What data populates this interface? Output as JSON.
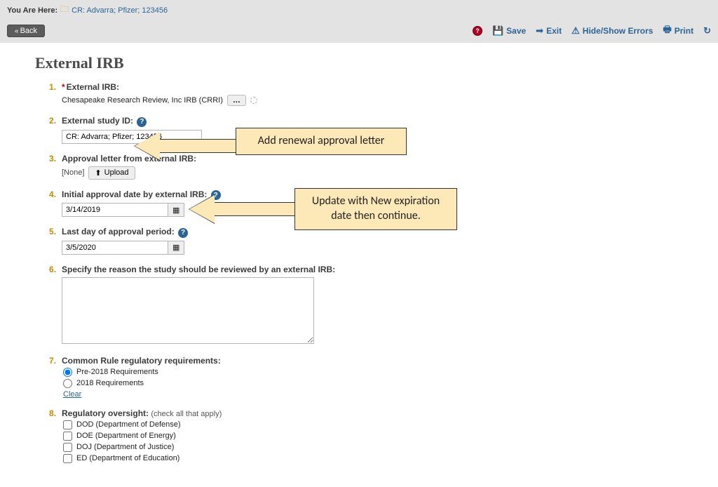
{
  "breadcrumb": {
    "label": "You Are Here:",
    "path": "CR: Advarra; Pfizer; 123456"
  },
  "toolbar": {
    "back": "Back",
    "save": "Save",
    "exit": "Exit",
    "errors": "Hide/Show Errors",
    "print": "Print"
  },
  "page_title": "External IRB",
  "q1": {
    "label": "External IRB:",
    "value": "Chesapeake Research Review, Inc IRB (CRRI)"
  },
  "q2": {
    "label": "External study ID:",
    "value": "CR: Advarra; Pfizer; 123456"
  },
  "q3": {
    "label": "Approval letter from external IRB:",
    "none": "[None]",
    "upload": "Upload"
  },
  "q4": {
    "label": "Initial approval date by external IRB:",
    "value": "3/14/2019"
  },
  "q5": {
    "label": "Last day of approval period:",
    "value": "3/5/2020"
  },
  "q6": {
    "label": "Specify the reason the study should be reviewed by an external IRB:",
    "value": ""
  },
  "q7": {
    "label": "Common Rule regulatory requirements:",
    "opt1": "Pre-2018 Requirements",
    "opt2": "2018 Requirements",
    "clear": "Clear"
  },
  "q8": {
    "label": "Regulatory oversight:",
    "hint": "(check all that apply)",
    "opt1": "DOD (Department of Defense)",
    "opt2": "DOE (Department of Energy)",
    "opt3": "DOJ (Department of Justice)",
    "opt4": "ED (Department of Education)"
  },
  "callout1": "Add renewal approval letter",
  "callout2_line1": "Update with New expiration",
  "callout2_line2": "date then continue."
}
